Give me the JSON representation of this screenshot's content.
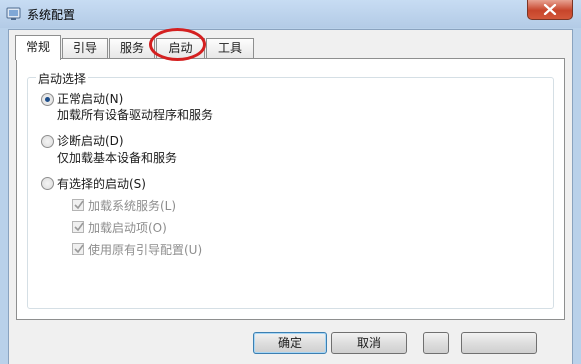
{
  "window": {
    "title": "系统配置",
    "close_symbol": "✕"
  },
  "tabs": [
    {
      "label": "常规",
      "active": true
    },
    {
      "label": "引导",
      "active": false
    },
    {
      "label": "服务",
      "active": false
    },
    {
      "label": "启动",
      "active": false,
      "highlighted": true
    },
    {
      "label": "工具",
      "active": false
    }
  ],
  "startup_group": {
    "legend": "启动选择",
    "options": [
      {
        "label": "正常启动(N)",
        "description": "加载所有设备驱动程序和服务",
        "selected": true
      },
      {
        "label": "诊断启动(D)",
        "description": "仅加载基本设备和服务",
        "selected": false
      },
      {
        "label": "有选择的启动(S)",
        "selected": false
      }
    ],
    "selective_items": [
      {
        "label": "加载系统服务(L)",
        "checked": true,
        "enabled": false
      },
      {
        "label": "加载启动项(O)",
        "checked": true,
        "enabled": false
      },
      {
        "label": "使用原有引导配置(U)",
        "checked": true,
        "enabled": false
      }
    ]
  },
  "buttons": {
    "ok": "确定",
    "cancel": "取消"
  },
  "colors": {
    "accent": "#1e4e8a",
    "annotation": "#d42020",
    "close": "#c7452b"
  }
}
